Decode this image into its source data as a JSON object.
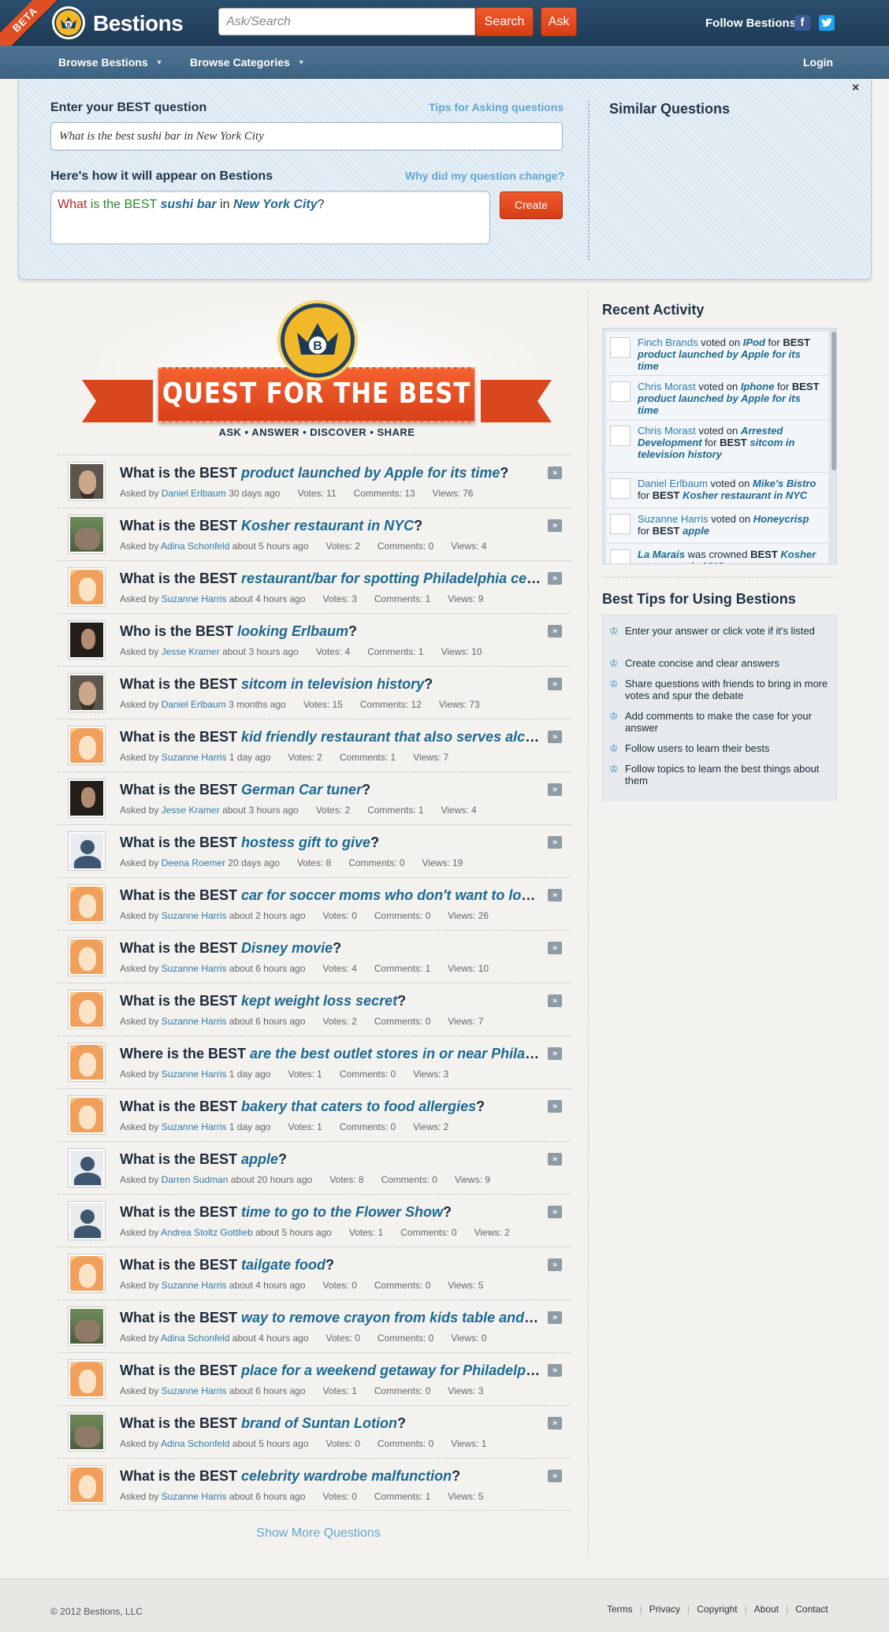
{
  "header": {
    "beta": "BETA",
    "logo": "Bestions",
    "search_placeholder": "Ask/Search",
    "search_label": "Search",
    "ask_label": "Ask",
    "follow_label": "Follow Bestions:",
    "facebook": "f",
    "twitter": "t"
  },
  "nav": {
    "browse_bestions": "Browse Bestions",
    "browse_categories": "Browse Categories",
    "login": "Login"
  },
  "ask_panel": {
    "close": "×",
    "enter_label": "Enter your BEST question",
    "tips_link": "Tips for Asking questions",
    "question_value": "What is the best sushi bar in New York City",
    "appear_label": "Here's how it will appear on Bestions",
    "why_link": "Why did my question change?",
    "preview": {
      "what": "What",
      "is": "is the",
      "best": "BEST",
      "item": "sushi bar",
      "in": "in",
      "place": "New York City",
      "end": "?"
    },
    "create_label": "Create",
    "similar_title": "Similar Questions"
  },
  "hero": {
    "crown_letter": "B",
    "banner": "QUEST FOR THE BEST",
    "tagline": "ASK • ANSWER • DISCOVER • SHARE"
  },
  "questions": [
    {
      "prefix": "What is the BEST",
      "item": "product launched by Apple for its time",
      "suffix": "?",
      "author": "Daniel Erlbaum",
      "age": "30 days ago",
      "votes": "Votes: 11",
      "comments": "Comments: 13",
      "views": "Views: 76",
      "avatar": "beard"
    },
    {
      "prefix": "What is the BEST",
      "item": "Kosher restaurant in NYC",
      "suffix": "?",
      "author": "Adina Schonfeld",
      "age": "about 5 hours ago",
      "votes": "Votes: 2",
      "comments": "Comments: 0",
      "views": "Views: 4",
      "avatar": "group"
    },
    {
      "prefix": "What is the BEST",
      "item": "restaurant/bar for spotting Philadelphia celebrities",
      "suffix": "?",
      "author": "Suzanne Harris",
      "age": "about 4 hours ago",
      "votes": "Votes: 3",
      "comments": "Comments: 1",
      "views": "Views: 9",
      "avatar": "ginger"
    },
    {
      "prefix": "Who is the BEST",
      "item": "looking Erlbaum",
      "suffix": "?",
      "author": "Jesse Kramer",
      "age": "about 3 hours ago",
      "votes": "Votes: 4",
      "comments": "Comments: 1",
      "views": "Views: 10",
      "avatar": "dark"
    },
    {
      "prefix": "What is the BEST",
      "item": "sitcom in television history",
      "suffix": "?",
      "author": "Daniel Erlbaum",
      "age": "3 months ago",
      "votes": "Votes: 15",
      "comments": "Comments: 12",
      "views": "Views: 73",
      "avatar": "beard"
    },
    {
      "prefix": "What is the BEST",
      "item": "kid friendly restaurant that also serves alcohol",
      "suffix": "?",
      "author": "Suzanne Harris",
      "age": "1 day ago",
      "votes": "Votes: 2",
      "comments": "Comments: 1",
      "views": "Views: 7",
      "avatar": "ginger"
    },
    {
      "prefix": "What is the BEST",
      "item": "German Car tuner",
      "suffix": "?",
      "author": "Jesse Kramer",
      "age": "about 3 hours ago",
      "votes": "Votes: 2",
      "comments": "Comments: 1",
      "views": "Views: 4",
      "avatar": "dark"
    },
    {
      "prefix": "What is the BEST",
      "item": "hostess gift to give",
      "suffix": "?",
      "author": "Deena Roemer",
      "age": "20 days ago",
      "votes": "Votes: 8",
      "comments": "Comments: 0",
      "views": "Views: 19",
      "avatar": "default"
    },
    {
      "prefix": "What is the BEST",
      "item": "car for soccer moms who don't want to look like soccer moms",
      "suffix": "?",
      "author": "Suzanne Harris",
      "age": "about 2 hours ago",
      "votes": "Votes: 0",
      "comments": "Comments: 0",
      "views": "Views: 26",
      "avatar": "ginger"
    },
    {
      "prefix": "What is the BEST",
      "item": "Disney movie",
      "suffix": "?",
      "author": "Suzanne Harris",
      "age": "about 6 hours ago",
      "votes": "Votes: 4",
      "comments": "Comments: 1",
      "views": "Views: 10",
      "avatar": "ginger"
    },
    {
      "prefix": "What is the BEST",
      "item": "kept weight loss secret",
      "suffix": "?",
      "author": "Suzanne Harris",
      "age": "about 6 hours ago",
      "votes": "Votes: 2",
      "comments": "Comments: 0",
      "views": "Views: 7",
      "avatar": "ginger"
    },
    {
      "prefix": "Where is the BEST",
      "item": "are the best outlet stores in or near Philadelphia",
      "suffix": "?",
      "author": "Suzanne Harris",
      "age": "1 day ago",
      "votes": "Votes: 1",
      "comments": "Comments: 0",
      "views": "Views: 3",
      "avatar": "ginger"
    },
    {
      "prefix": "What is the BEST",
      "item": "bakery that caters to food allergies",
      "suffix": "?",
      "author": "Suzanne Harris",
      "age": "1 day ago",
      "votes": "Votes: 1",
      "comments": "Comments: 0",
      "views": "Views: 2",
      "avatar": "ginger"
    },
    {
      "prefix": "What is the BEST",
      "item": "apple",
      "suffix": "?",
      "author": "Darren Sudman",
      "age": "about 20 hours ago",
      "votes": "Votes: 8",
      "comments": "Comments: 0",
      "views": "Views: 9",
      "avatar": "default"
    },
    {
      "prefix": "What is the BEST",
      "item": "time to go to the Flower Show",
      "suffix": "?",
      "author": "Andrea Stoltz Gottlieb",
      "age": "about 5 hours ago",
      "votes": "Votes: 1",
      "comments": "Comments: 0",
      "views": "Views: 2",
      "avatar": "default"
    },
    {
      "prefix": "What is the BEST",
      "item": "tailgate food",
      "suffix": "?",
      "author": "Suzanne Harris",
      "age": "about 4 hours ago",
      "votes": "Votes: 0",
      "comments": "Comments: 0",
      "views": "Views: 5",
      "avatar": "ginger"
    },
    {
      "prefix": "What is the BEST",
      "item": "way to remove crayon from kids table and chairs",
      "suffix": "?",
      "author": "Adina Schonfeld",
      "age": "about 4 hours ago",
      "votes": "Votes: 0",
      "comments": "Comments: 0",
      "views": "Views: 0",
      "avatar": "group"
    },
    {
      "prefix": "What is the BEST",
      "item": "place for a weekend getaway for Philadelphians",
      "suffix": "?",
      "author": "Suzanne Harris",
      "age": "about 6 hours ago",
      "votes": "Votes: 1",
      "comments": "Comments: 0",
      "views": "Views: 3",
      "avatar": "ginger"
    },
    {
      "prefix": "What is the BEST",
      "item": "brand of Suntan Lotion",
      "suffix": "?",
      "author": "Adina Schonfeld",
      "age": "about 5 hours ago",
      "votes": "Votes: 0",
      "comments": "Comments: 0",
      "views": "Views: 1",
      "avatar": "group"
    },
    {
      "prefix": "What is the BEST",
      "item": "celebrity wardrobe malfunction",
      "suffix": "?",
      "author": "Suzanne Harris",
      "age": "about 6 hours ago",
      "votes": "Votes: 0",
      "comments": "Comments: 1",
      "views": "Views: 5",
      "avatar": "ginger"
    }
  ],
  "asked_by": "Asked by",
  "show_more": "Show More Questions",
  "recent_activity": {
    "title": "Recent Activity",
    "items": [
      {
        "user": "Finch Brands",
        "verb": "voted on",
        "item": "IPod",
        "for": "for",
        "best": "BEST",
        "target": "product launched by Apple for its time"
      },
      {
        "user": "Chris Morast",
        "verb": "voted on",
        "item": "Iphone",
        "for": "for",
        "best": "BEST",
        "target": "product launched by Apple for its time"
      },
      {
        "user": "Chris Morast",
        "verb": "voted on",
        "item": "Arrested Development",
        "for": "for",
        "best": "BEST",
        "target": "sitcom in television history"
      },
      {
        "user": "Daniel Erlbaum",
        "verb": "voted on",
        "item": "Mike's Bistro",
        "for": "for",
        "best": "BEST",
        "target": "Kosher restaurant in NYC"
      },
      {
        "user": "Suzanne Harris",
        "verb": "voted on",
        "item": "Honeycrisp",
        "for": "for",
        "best": "BEST",
        "target": "apple"
      },
      {
        "user": "La Marais",
        "verb": "was crowned",
        "item": "",
        "for": "",
        "best": "BEST",
        "target": "Kosher restaurant in NYC"
      }
    ]
  },
  "tips": {
    "title": "Best Tips for Using Bestions",
    "items": [
      "Enter your answer or click vote if it's listed",
      "Create concise and clear answers",
      "Share questions with friends to bring in more votes and spur the debate",
      "Add comments to make the case for your answer",
      "Follow users to learn their bests",
      "Follow topics to learn the best things about them"
    ]
  },
  "footer": {
    "copyright": "© 2012 Bestions, LLC",
    "links": [
      "Terms",
      "Privacy",
      "Copyright",
      "About",
      "Contact"
    ]
  },
  "colors": {
    "accent_orange": "#e04e24",
    "nav_blue": "#3d6383",
    "link_blue": "#2f7bab",
    "item_blue": "#1d6990"
  }
}
